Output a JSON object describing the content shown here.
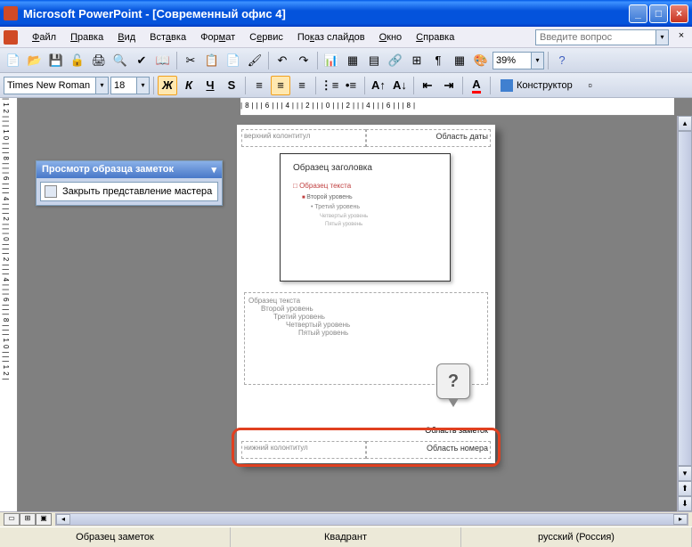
{
  "titlebar": {
    "app": "Microsoft PowerPoint",
    "doc": "[Современный офис 4]",
    "full": "Microsoft PowerPoint - [Современный офис 4]"
  },
  "menu": {
    "file": "Файл",
    "edit": "Правка",
    "view": "Вид",
    "insert": "Вставка",
    "format": "Формат",
    "tools": "Сервис",
    "slideshow": "Показ слайдов",
    "window": "Окно",
    "help": "Справка",
    "help_placeholder": "Введите вопрос"
  },
  "toolbar": {
    "zoom": "39%"
  },
  "format_bar": {
    "font": "Times New Roman",
    "size": "18",
    "designer": "Конструктор"
  },
  "ruler_h": "|8|||6|||4|||2|||0|||2|||4|||6|||8|",
  "ruler_v": "|12|||10|||8|||6|||4|||2|||0|||2|||4|||6|||8|||10|||12|",
  "floating_panel": {
    "title": "Просмотр образца заметок",
    "close_master": "Закрыть представление мастера"
  },
  "notes_master": {
    "header_left": "верхний колонтитул",
    "header_right": "Область даты",
    "slide_title": "Образец заголовка",
    "slide_l1": "Образец текста",
    "slide_l2": "Второй уровень",
    "slide_l3": "Третий уровень",
    "slide_l4": "Четвертый уровень",
    "slide_l5": "Пятый уровень",
    "notes_l1": "Образец текста",
    "notes_l2": "Второй уровень",
    "notes_l3": "Третий уровень",
    "notes_l4": "Четвертый уровень",
    "notes_l5": "Пятый уровень",
    "footer_notes_label": "Область заметок",
    "footer_left": "нижний колонтитул",
    "footer_right": "Область номера"
  },
  "callout": "?",
  "status": {
    "left": "Образец заметок",
    "center": "Квадрант",
    "right": "русский (Россия)"
  }
}
